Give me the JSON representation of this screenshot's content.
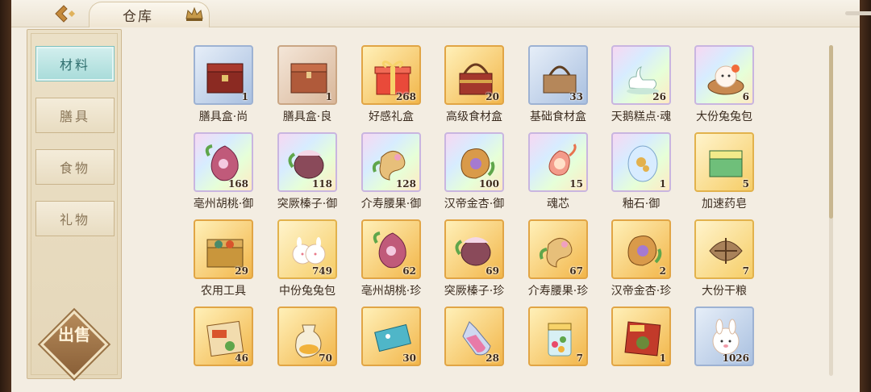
{
  "header": {
    "title": "仓库"
  },
  "sidebar": {
    "tabs": [
      {
        "label": "材料",
        "active": true
      },
      {
        "label": "膳具",
        "active": false
      },
      {
        "label": "食物",
        "active": false
      },
      {
        "label": "礼物",
        "active": false
      }
    ],
    "sell_label": "出售"
  },
  "colors": {
    "accent_teal": "#a7dbd9",
    "panel": "#e5d7b9",
    "background": "#f3ede2"
  },
  "items": [
    {
      "name": "膳具盒·尚",
      "count": "1",
      "frame": "blue",
      "icon": "red-lacquer-box-icon"
    },
    {
      "name": "膳具盒·良",
      "count": "1",
      "frame": "brown",
      "icon": "wooden-chest-icon"
    },
    {
      "name": "好感礼盒",
      "count": "268",
      "frame": "gold",
      "icon": "gift-box-icon"
    },
    {
      "name": "高级食材盒",
      "count": "20",
      "frame": "gold",
      "icon": "food-basket-icon"
    },
    {
      "name": "基础食材盒",
      "count": "33",
      "frame": "blue",
      "icon": "basket-icon"
    },
    {
      "name": "天鹅糕点·魂",
      "count": "26",
      "frame": "rainbow",
      "icon": "swan-pastry-icon"
    },
    {
      "name": "大份兔兔包",
      "count": "6",
      "frame": "rainbow",
      "icon": "bun-steamer-icon"
    },
    {
      "name": "亳州胡桃·御",
      "count": "168",
      "frame": "rainbow",
      "icon": "walnut-icon"
    },
    {
      "name": "突厥榛子·御",
      "count": "118",
      "frame": "rainbow",
      "icon": "hazelnut-icon"
    },
    {
      "name": "介寿腰果·御",
      "count": "128",
      "frame": "rainbow",
      "icon": "cashew-icon"
    },
    {
      "name": "汉帝金杏·御",
      "count": "100",
      "frame": "rainbow",
      "icon": "apricot-icon"
    },
    {
      "name": "魂芯",
      "count": "15",
      "frame": "rainbow",
      "icon": "soul-core-icon"
    },
    {
      "name": "釉石·御",
      "count": "1",
      "frame": "rainbow",
      "icon": "glaze-stone-icon"
    },
    {
      "name": "加速药皂",
      "count": "5",
      "frame": "yellow",
      "icon": "soap-icon"
    },
    {
      "name": "农用工具",
      "count": "29",
      "frame": "gold",
      "icon": "toolbox-icon"
    },
    {
      "name": "中份兔兔包",
      "count": "749",
      "frame": "yellow",
      "icon": "bunny-buns-icon"
    },
    {
      "name": "亳州胡桃·珍",
      "count": "62",
      "frame": "gold",
      "icon": "walnut-icon"
    },
    {
      "name": "突厥榛子·珍",
      "count": "69",
      "frame": "gold",
      "icon": "hazelnut-icon"
    },
    {
      "name": "介寿腰果·珍",
      "count": "67",
      "frame": "gold",
      "icon": "cashew-icon"
    },
    {
      "name": "汉帝金杏·珍",
      "count": "2",
      "frame": "gold",
      "icon": "apricot-icon"
    },
    {
      "name": "大份干粮",
      "count": "7",
      "frame": "yellow",
      "icon": "ration-bundle-icon"
    },
    {
      "name": "",
      "count": "46",
      "frame": "gold",
      "icon": "scroll-recipe-icon"
    },
    {
      "name": "",
      "count": "70",
      "frame": "gold",
      "icon": "potion-bag-icon"
    },
    {
      "name": "",
      "count": "30",
      "frame": "gold",
      "icon": "ticket-icon"
    },
    {
      "name": "",
      "count": "28",
      "frame": "gold",
      "icon": "crystal-vial-icon"
    },
    {
      "name": "",
      "count": "7",
      "frame": "gold",
      "icon": "candy-jar-icon"
    },
    {
      "name": "",
      "count": "1",
      "frame": "gold",
      "icon": "red-poster-icon"
    },
    {
      "name": "",
      "count": "1026",
      "frame": "blue",
      "icon": "bunny-bun-icon"
    }
  ]
}
